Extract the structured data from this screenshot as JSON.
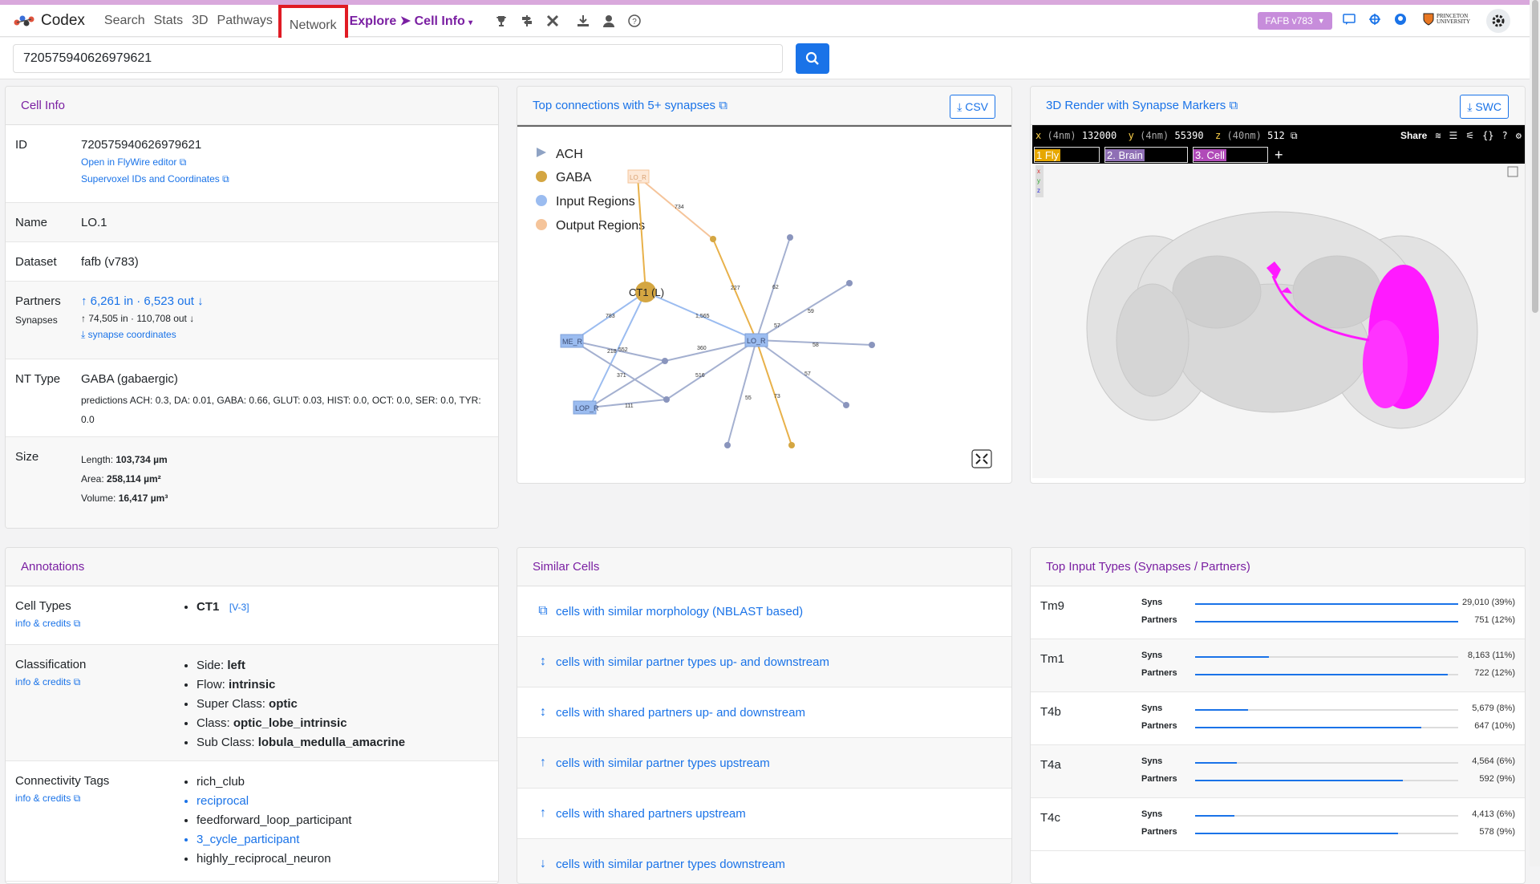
{
  "nav": {
    "brand": "Codex",
    "items": [
      "Search",
      "Stats",
      "3D",
      "Pathways"
    ],
    "active": "Network",
    "explore": "Explore",
    "cell_info": "Cell Info",
    "version_badge": "FAFB v783",
    "institution": "PRINCETON UNIVERSITY"
  },
  "search": {
    "value": "720575940626979621"
  },
  "cell_info": {
    "title": "Cell Info",
    "id_label": "ID",
    "id_value": "720575940626979621",
    "id_link1": "Open in FlyWire editor",
    "id_link2": "Supervoxel IDs and Coordinates",
    "name_label": "Name",
    "name_value": "LO.1",
    "dataset_label": "Dataset",
    "dataset_value": "fafb (v783)",
    "partners_label": "Partners",
    "partners_in": "6,261 in",
    "partners_sep": " · ",
    "partners_out": "6,523 out",
    "synapses_label": "Synapses",
    "synapses_value": "74,505 in · 110,708 out",
    "synapse_coords": "synapse coordinates",
    "nt_label": "NT Type",
    "nt_value": "GABA (gabaergic)",
    "nt_predictions": "predictions ACH: 0.3, DA: 0.01, GABA: 0.66, GLUT: 0.03, HIST: 0.0, OCT: 0.0, SER: 0.0, TYR: 0.0",
    "size_label": "Size",
    "length_label": "Length: ",
    "length_value": "103,734 µm",
    "area_label": "Area: ",
    "area_value": "258,114 µm²",
    "volume_label": "Volume: ",
    "volume_value": "16,417 µm³"
  },
  "network": {
    "title": "Top connections with 5+ synapses",
    "csv": "CSV",
    "legend": [
      "ACH",
      "GABA",
      "Input Regions",
      "Output Regions"
    ],
    "nodes": {
      "ct1": "CT1 (L)",
      "lo_r": "LO_R",
      "me_r": "ME_R",
      "lop_r": "LOP_R",
      "lo_r_top": "LO_R"
    },
    "edge_labels": [
      "734",
      "227",
      "62",
      "59",
      "57",
      "1,565",
      "783",
      "218",
      "552",
      "360",
      "371",
      "516",
      "111",
      "58",
      "57",
      "55",
      "73"
    ]
  },
  "render": {
    "title": "3D Render with Synapse Markers",
    "swc": "SWC",
    "coord_x_label": "x",
    "coord_x_unit": "(4nm)",
    "coord_x": "132000",
    "coord_y_label": "y",
    "coord_y_unit": "(4nm)",
    "coord_y": "55390",
    "coord_z_label": "z",
    "coord_z_unit": "(40nm)",
    "coord_z": "512",
    "share": "Share",
    "layers": [
      "1 Fly",
      "2. Brain",
      "3. Cell"
    ],
    "add": "+",
    "axis_x": "x",
    "axis_y": "y",
    "axis_z": "z"
  },
  "annotations": {
    "title": "Annotations",
    "cell_types_label": "Cell Types",
    "info_credits": "info & credits",
    "cell_type": "CT1",
    "cell_type_ver": "[V-3]",
    "classification_label": "Classification",
    "classification": [
      {
        "k": "Side: ",
        "v": "left"
      },
      {
        "k": "Flow: ",
        "v": "intrinsic"
      },
      {
        "k": "Super Class: ",
        "v": "optic"
      },
      {
        "k": "Class: ",
        "v": "optic_lobe_intrinsic"
      },
      {
        "k": "Sub Class: ",
        "v": "lobula_medulla_amacrine"
      }
    ],
    "conn_tags_label": "Connectivity Tags",
    "conn_tags": [
      "rich_club",
      "reciprocal",
      "feedforward_loop_participant",
      "3_cycle_participant",
      "highly_reciprocal_neuron"
    ]
  },
  "similar": {
    "title": "Similar Cells",
    "items": [
      "cells with similar morphology (NBLAST based)",
      "cells with similar partner types up- and downstream",
      "cells with shared partners up- and downstream",
      "cells with similar partner types upstream",
      "cells with shared partners upstream",
      "cells with similar partner types downstream"
    ]
  },
  "top_inputs": {
    "title": "Top Input Types (Synapses / Partners)",
    "syns_label": "Syns",
    "partners_label": "Partners",
    "rows": [
      {
        "name": "Tm9",
        "syns": "29,010 (39%)",
        "syns_frac": 1.0,
        "partners": "751 (12%)",
        "partners_frac": 1.0
      },
      {
        "name": "Tm1",
        "syns": "8,163 (11%)",
        "syns_frac": 0.28,
        "partners": "722 (12%)",
        "partners_frac": 0.96
      },
      {
        "name": "T4b",
        "syns": "5,679 (8%)",
        "syns_frac": 0.2,
        "partners": "647 (10%)",
        "partners_frac": 0.86
      },
      {
        "name": "T4a",
        "syns": "4,564 (6%)",
        "syns_frac": 0.16,
        "partners": "592 (9%)",
        "partners_frac": 0.79
      },
      {
        "name": "T4c",
        "syns": "4,413 (6%)",
        "syns_frac": 0.15,
        "partners": "578 (9%)",
        "partners_frac": 0.77
      }
    ]
  },
  "colors": {
    "accent": "#1a73e8",
    "brand": "#7a1fa2",
    "highlight": "#e01b24",
    "gaba": "#d4a642",
    "input_region": "#9bbcf0",
    "output_region": "#f5c49a",
    "cell_render": "#ff1aff"
  }
}
